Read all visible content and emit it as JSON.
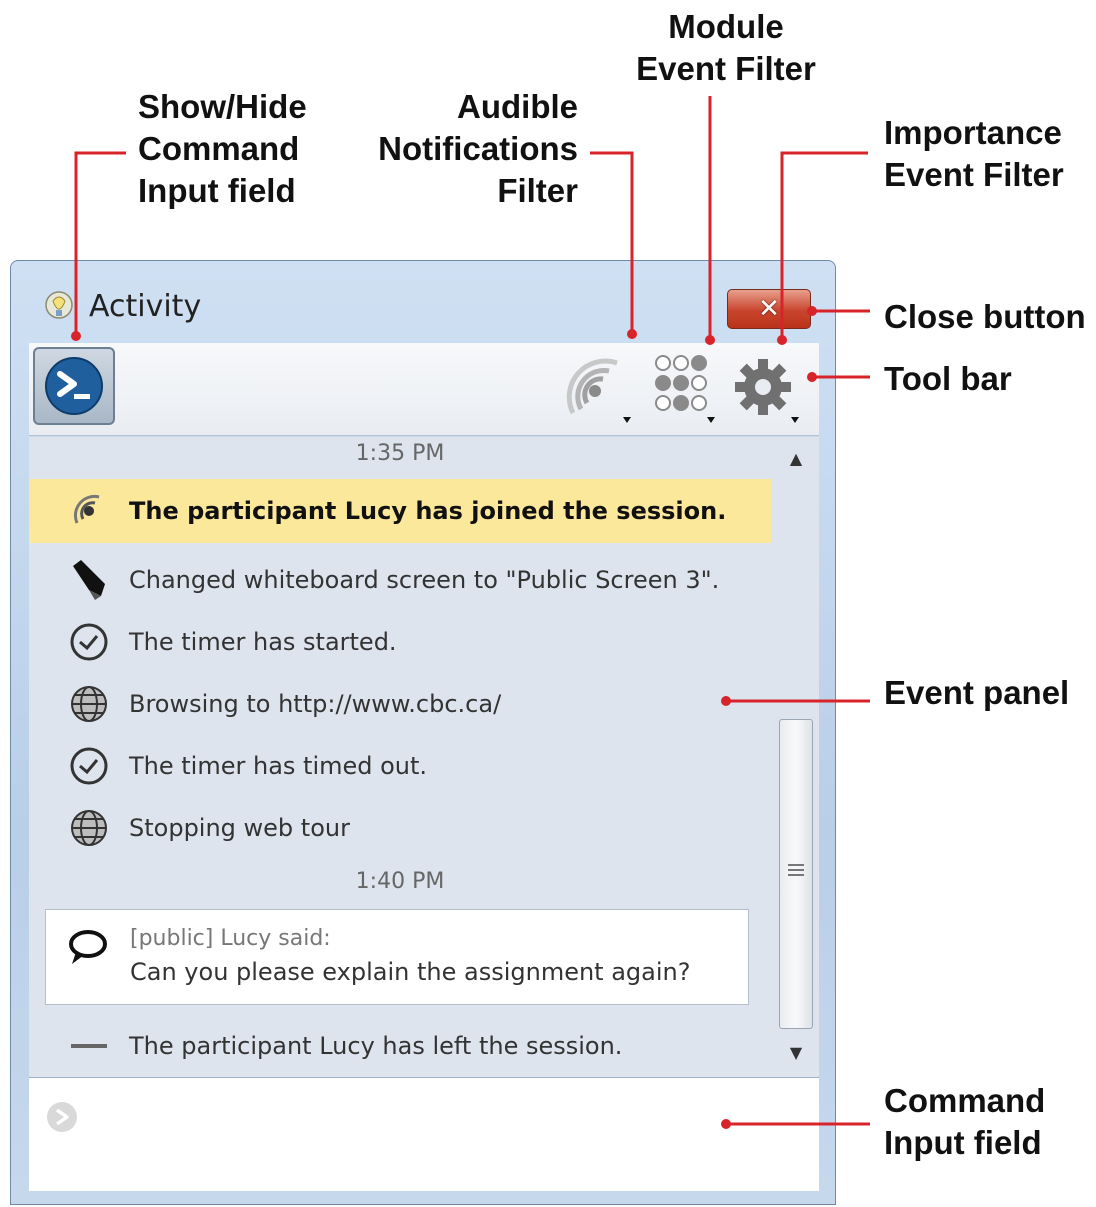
{
  "callouts": {
    "show_hide": [
      "Show/Hide",
      "Command",
      "Input field"
    ],
    "audible": [
      "Audible",
      "Notifications",
      "Filter"
    ],
    "module": [
      "Module",
      "Event Filter"
    ],
    "importance": [
      "Importance",
      "Event Filter"
    ],
    "close": "Close button",
    "toolbar": "Tool bar",
    "event_panel": "Event panel",
    "command_input": [
      "Command",
      "Input field"
    ]
  },
  "window": {
    "title": "Activity",
    "close_label": "✕"
  },
  "toolbar": {
    "buttons": [
      {
        "icon": "command-prompt-icon"
      },
      {
        "icon": "audible-notifications-icon",
        "dropdown": true
      },
      {
        "icon": "module-filter-icon",
        "dropdown": true
      },
      {
        "icon": "gear-icon",
        "dropdown": true
      }
    ]
  },
  "events": {
    "timestamp_1": "1:35 PM",
    "timestamp_2": "1:40 PM",
    "items": [
      {
        "icon": "audio-icon",
        "text": "The participant Lucy has joined the session.",
        "highlight": true
      },
      {
        "icon": "marker-icon",
        "text": "Changed whiteboard screen to \"Public Screen 3\"."
      },
      {
        "icon": "clock-icon",
        "text": "The timer has started."
      },
      {
        "icon": "globe-icon",
        "text": "Browsing to http://www.cbc.ca/"
      },
      {
        "icon": "clock-icon",
        "text": "The timer has timed out."
      },
      {
        "icon": "globe-icon",
        "text": "Stopping web tour"
      }
    ],
    "chat": {
      "header": "[public] Lucy said:",
      "message": "Can you please explain the assignment again?"
    },
    "last": {
      "icon": "dash-icon",
      "text": "The participant Lucy has left the session."
    }
  },
  "colors": {
    "accent_red": "#d8232a",
    "highlight": "#fbe89b",
    "panel": "#dde4ee"
  }
}
